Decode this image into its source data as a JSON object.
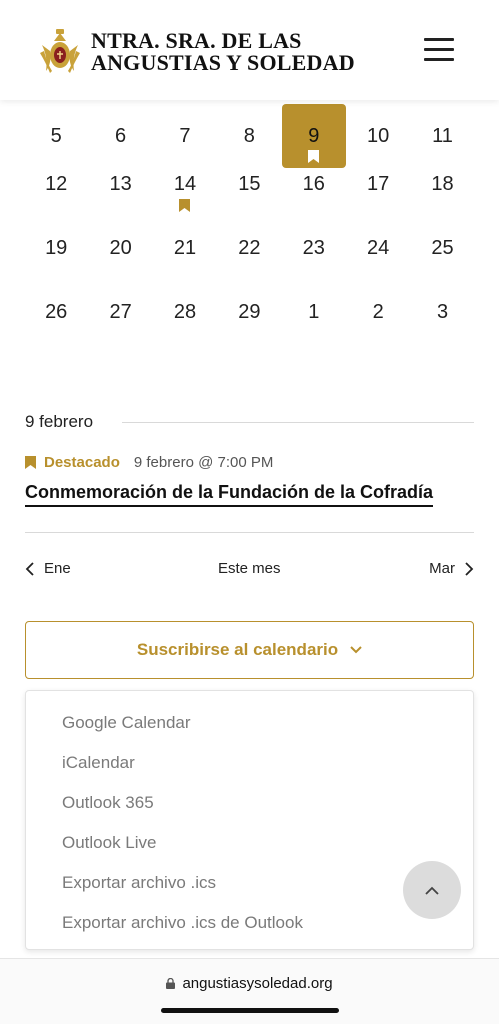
{
  "header": {
    "brand_line1": "NTRA. SRA. DE LAS",
    "brand_line2": "ANGUSTIAS Y SOLEDAD",
    "logo_icon": "crest-logo-icon",
    "menu_icon": "hamburger-menu-icon"
  },
  "colors": {
    "accent": "#b8902d",
    "text": "#222222",
    "muted": "#7a7a7a"
  },
  "calendar": {
    "rows": [
      [
        "5",
        "6",
        "7",
        "8",
        "9",
        "10",
        "11"
      ],
      [
        "12",
        "13",
        "14",
        "15",
        "16",
        "17",
        "18"
      ],
      [
        "19",
        "20",
        "21",
        "22",
        "23",
        "24",
        "25"
      ],
      [
        "26",
        "27",
        "28",
        "29",
        "1",
        "2",
        "3"
      ]
    ],
    "selected_day": "9",
    "featured_days": [
      "9",
      "14"
    ]
  },
  "events": {
    "date_heading": "9 febrero",
    "featured_label": "Destacado",
    "datetime": "9 febrero @ 7:00 PM",
    "title": "Conmemoración de la Fundación de la Cofradía"
  },
  "nav": {
    "prev": "Ene",
    "current": "Este mes",
    "next": "Mar"
  },
  "subscribe": {
    "label": "Suscribirse al calendario",
    "options": [
      "Google Calendar",
      "iCalendar",
      "Outlook 365",
      "Outlook Live",
      "Exportar archivo .ics",
      "Exportar archivo .ics de Outlook"
    ]
  },
  "browser": {
    "url": "angustiasysoledad.org"
  }
}
